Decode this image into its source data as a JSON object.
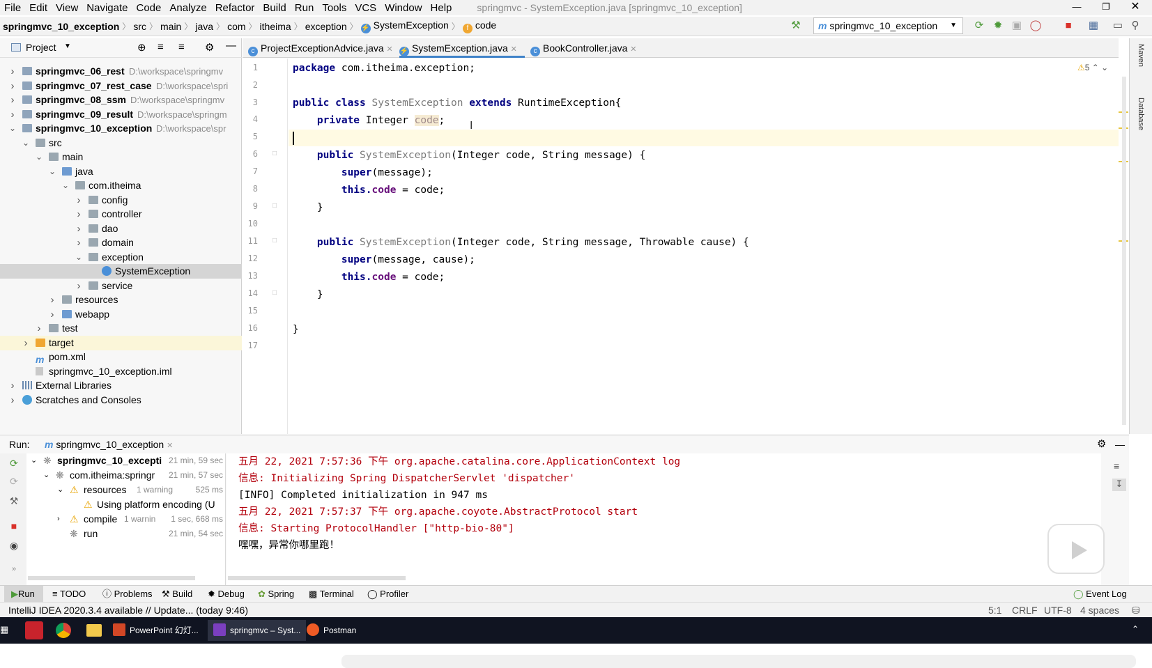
{
  "menu": {
    "items": [
      "File",
      "Edit",
      "View",
      "Navigate",
      "Code",
      "Analyze",
      "Refactor",
      "Build",
      "Run",
      "Tools",
      "VCS",
      "Window",
      "Help"
    ],
    "title": "springmvc - SystemException.java [springmvc_10_exception]"
  },
  "breadcrumb": [
    "springmvc_10_exception",
    "src",
    "main",
    "java",
    "com",
    "itheima",
    "exception",
    "SystemException",
    "code"
  ],
  "run_config": "springmvc_10_exception",
  "project": {
    "header": "Project",
    "rows": [
      {
        "label": "springmvc_06_rest",
        "path": "D:\\workspace\\springmv"
      },
      {
        "label": "springmvc_07_rest_case",
        "path": "D:\\workspace\\spri"
      },
      {
        "label": "springmvc_08_ssm",
        "path": "D:\\workspace\\springmv"
      },
      {
        "label": "springmvc_09_result",
        "path": "D:\\workspace\\springm"
      },
      {
        "label": "springmvc_10_exception",
        "path": "D:\\workspace\\spr"
      },
      {
        "label": "src"
      },
      {
        "label": "main"
      },
      {
        "label": "java"
      },
      {
        "label": "com.itheima"
      },
      {
        "label": "config"
      },
      {
        "label": "controller"
      },
      {
        "label": "dao"
      },
      {
        "label": "domain"
      },
      {
        "label": "exception"
      },
      {
        "label": "SystemException"
      },
      {
        "label": "service"
      },
      {
        "label": "resources"
      },
      {
        "label": "webapp"
      },
      {
        "label": "test"
      },
      {
        "label": "target"
      },
      {
        "label": "pom.xml"
      },
      {
        "label": "springmvc_10_exception.iml"
      },
      {
        "label": "External Libraries"
      },
      {
        "label": "Scratches and Consoles"
      }
    ]
  },
  "tabs": [
    "ProjectExceptionAdvice.java",
    "SystemException.java",
    "BookController.java"
  ],
  "editor": {
    "warnings": "5",
    "line_numbers": [
      "1",
      "2",
      "3",
      "4",
      "5",
      "6",
      "7",
      "8",
      "9",
      "10",
      "11",
      "12",
      "13",
      "14",
      "15",
      "16",
      "17"
    ],
    "lines": {
      "l1a": "package ",
      "l1b": "com.itheima.exception;",
      "l3a": "public class ",
      "l3b": "SystemException ",
      "l3c": "extends ",
      "l3d": "RuntimeException{",
      "l4a": "    private ",
      "l4b": "Integer ",
      "l4c": "code",
      "l4d": ";",
      "l6a": "    public ",
      "l6b": "SystemException",
      "l6c": "(Integer code, String message) {",
      "l7a": "        super",
      "l7b": "(message);",
      "l8a": "        this.",
      "l8b": "code",
      "l8c": " = code;",
      "l9": "    }",
      "l11a": "    public ",
      "l11b": "SystemException",
      "l11c": "(Integer code, String message, Throwable cause) {",
      "l12a": "        super",
      "l12b": "(message, cause);",
      "l13a": "        this.",
      "l13b": "code",
      "l13c": " = code;",
      "l14": "    }",
      "l16": "}"
    }
  },
  "run": {
    "label": "Run:",
    "tab": "springmvc_10_exception",
    "tree": [
      {
        "label": "springmvc_10_excepti",
        "time": "21 min, 59 sec"
      },
      {
        "label": "com.itheima:springr",
        "time": "21 min, 57 sec"
      },
      {
        "label": "resources",
        "extra": "1 warning",
        "time": "525 ms"
      },
      {
        "label": "Using platform encoding (U"
      },
      {
        "label": "compile",
        "extra": "1 warnin",
        "time": "1 sec, 668 ms"
      },
      {
        "label": "run",
        "time": "21 min, 54 sec"
      }
    ],
    "console": [
      "五月 22, 2021 7:57:36 下午 org.apache.catalina.core.ApplicationContext log",
      "信息: Initializing Spring DispatcherServlet 'dispatcher'",
      "[INFO] Completed initialization in 947 ms",
      "五月 22, 2021 7:57:37 下午 org.apache.coyote.AbstractProtocol start",
      "信息: Starting ProtocolHandler [\"http-bio-80\"]",
      "嘿嘿，异常你哪里跑！"
    ]
  },
  "bottom_tabs": [
    "Run",
    "TODO",
    "Problems",
    "Build",
    "Debug",
    "Spring",
    "Terminal",
    "Profiler",
    "Event Log"
  ],
  "status": {
    "message": "IntelliJ IDEA 2020.3.4 available // Update... (today 9:46)",
    "position": "5:1",
    "line_sep": "CRLF",
    "encoding": "UTF-8",
    "indent": "4 spaces"
  },
  "right_tools": [
    "Maven",
    "Database"
  ],
  "taskbar": [
    "PowerPoint 幻灯...",
    "springmvc – Syst...",
    "Postman"
  ]
}
